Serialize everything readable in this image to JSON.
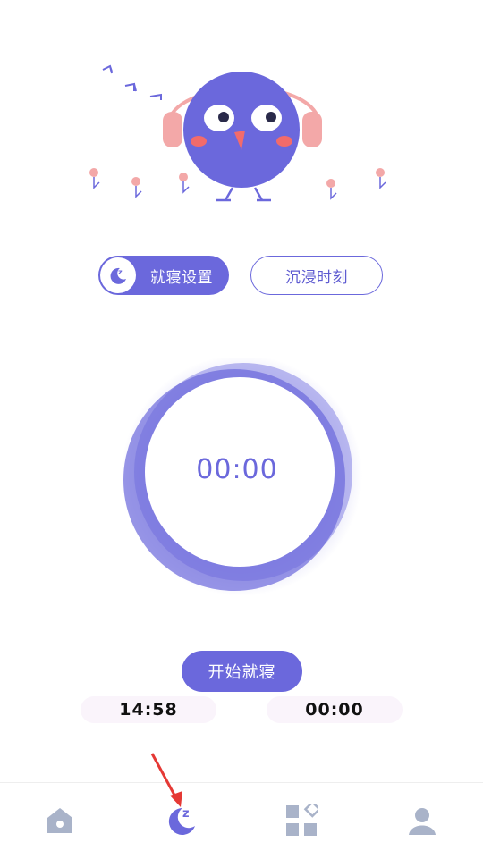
{
  "tabs": {
    "sleep_label": "就寝设置",
    "immerse_label": "沉浸时刻"
  },
  "timer": {
    "display": "00:00"
  },
  "actions": {
    "start_label": "开始就寝"
  },
  "times": {
    "left": "14:58",
    "right": "00:00"
  },
  "nav": {
    "items": [
      "home-icon",
      "sleep-moon-icon",
      "apps-grid-icon",
      "profile-icon"
    ],
    "active_index": 1
  },
  "colors": {
    "accent": "#6b68dc",
    "pill_bg": "#faf4fb",
    "nav_icon": "#a9b3c9",
    "bird_cheek": "#f26b6b",
    "headphone": "#f3a8a8"
  }
}
